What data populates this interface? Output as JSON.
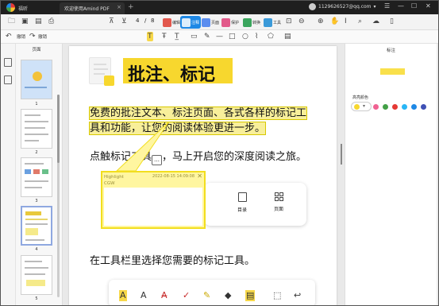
{
  "titlebar": {
    "app_name": "福昕",
    "tab_title": "欢迎使用Amind PDF",
    "account": "1129626527@qq.com"
  },
  "toolbar": {
    "page_current": "4",
    "page_total": "8",
    "modes": [
      {
        "label": "编辑",
        "color": "#e2574c"
      },
      {
        "label": "注释",
        "color": "#ffffff"
      },
      {
        "label": "页面",
        "color": "#5b8def"
      },
      {
        "label": "保护",
        "color": "#e25a8a"
      },
      {
        "label": "转换",
        "color": "#3aa55d"
      },
      {
        "label": "工具",
        "color": "#3b9ad9"
      }
    ]
  },
  "annbar": {
    "undo_label": "撤销",
    "redo_label": "撤销"
  },
  "thumbnails": {
    "header": "页面",
    "pages": [
      "1",
      "2",
      "3",
      "4",
      "5"
    ]
  },
  "document": {
    "title": "批注、标记",
    "highlight_text": "免费的批注文本、标注页面、各式各样的标记工具和功能，让您的阅读体验更进一步。",
    "line2_before": "点触标记工具",
    "line2_icon": "…",
    "line2_after": "，马上开启您的深度阅读之旅。",
    "line3": "在工具栏里选择您需要的标记工具。",
    "popup": {
      "type": "Highlight",
      "author": "CGW",
      "date": "2022-08-15 14:09:08"
    },
    "nav_outline": "目录",
    "nav_pages": "页面"
  },
  "right_panel": {
    "title": "标注",
    "highlight_color_label": "高亮颜色",
    "current_color": "#f7d72e",
    "palette": [
      "#f06292",
      "#43a047",
      "#e53935",
      "#29b6f6",
      "#1e88e5",
      "#3f51b5"
    ]
  }
}
